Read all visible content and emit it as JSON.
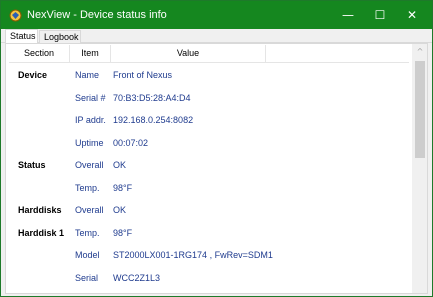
{
  "window": {
    "title": "NexView - Device status info",
    "controls": {
      "minimize": "—",
      "maximize": "☐",
      "close": "✕"
    }
  },
  "tabs": [
    {
      "label": "Status",
      "selected": true
    },
    {
      "label": "Logbook",
      "selected": false
    }
  ],
  "table": {
    "columns": [
      "Section",
      "Item",
      "Value"
    ],
    "rows": [
      {
        "section": "Device",
        "item": "Name",
        "value": "Front of Nexus"
      },
      {
        "section": "",
        "item": "Serial #",
        "value": "70:B3:D5:28:A4:D4"
      },
      {
        "section": "",
        "item": "IP addr.",
        "value": "192.168.0.254:8082"
      },
      {
        "section": "",
        "item": "Uptime",
        "value": "00:07:02"
      },
      {
        "section": "Status",
        "item": "Overall",
        "value": "OK"
      },
      {
        "section": "",
        "item": "Temp.",
        "value": "98°F"
      },
      {
        "section": "Harddisks",
        "item": "Overall",
        "value": "OK"
      },
      {
        "section": "Harddisk 1",
        "item": "Temp.",
        "value": "98°F"
      },
      {
        "section": "",
        "item": "Model",
        "value": "ST2000LX001-1RG174 , FwRev=SDM1"
      },
      {
        "section": "",
        "item": "Serial",
        "value": "WCC2Z1L3"
      }
    ]
  },
  "scrollbar": {
    "up_glyph": "^"
  },
  "colors": {
    "titlebar": "#15871f",
    "value_text": "#1f3b8e",
    "section_text": "#000000"
  }
}
